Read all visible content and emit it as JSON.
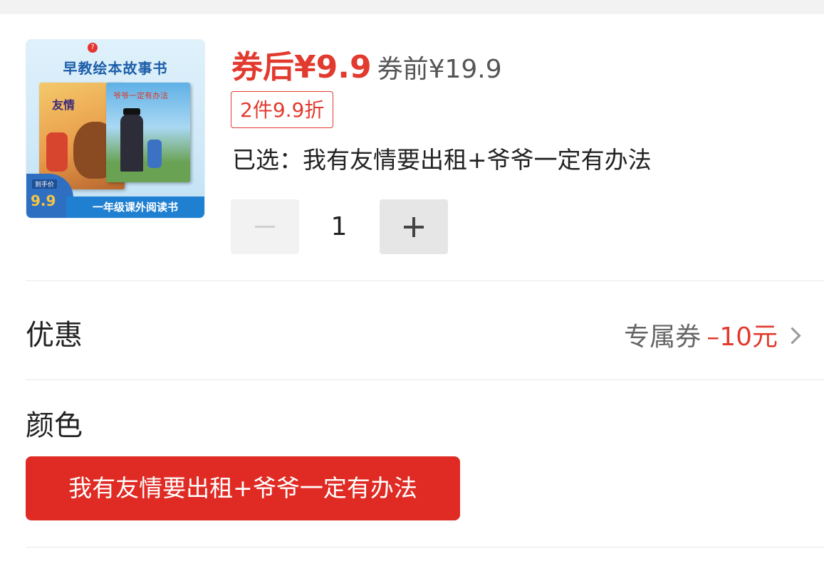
{
  "product": {
    "thumbnail": {
      "brand_mark": "?",
      "title": "早教绘本故事书",
      "book1_title": "友情",
      "book2_title": "爷爷一定有办法",
      "price_badge_label": "到手价",
      "price_badge_value": "9.9",
      "bottom_strip": "一年级课外阅读书"
    },
    "price_after": "券后¥9.9",
    "price_before": "券前¥19.9",
    "promo_tag": "2件9.9折",
    "selected_text": "已选：我有友情要出租+爷爷一定有办法",
    "quantity": "1"
  },
  "discount": {
    "label": "优惠",
    "coupon_name": "专属券",
    "coupon_amount": "–10元"
  },
  "color": {
    "label": "颜色",
    "options": [
      "我有友情要出租+爷爷一定有办法"
    ],
    "selected_index": 0
  },
  "colors": {
    "accent_red": "#e23a2e",
    "button_red": "#e02b24"
  },
  "icons": {
    "minus": "minus-icon",
    "plus": "plus-icon",
    "chevron": "chevron-right-icon"
  }
}
